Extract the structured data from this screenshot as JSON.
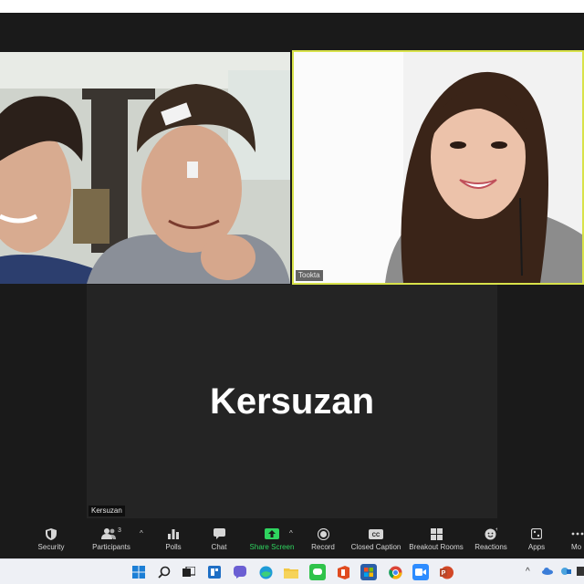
{
  "participants": [
    {
      "id": "p1",
      "name": ""
    },
    {
      "id": "p2",
      "name": "Tookta"
    },
    {
      "id": "p3",
      "name": "Kersuzan",
      "display_name": "Kersuzan"
    }
  ],
  "toolbar": {
    "security": "Security",
    "participants": "Participants",
    "participants_count": "3",
    "polls": "Polls",
    "chat": "Chat",
    "share_screen": "Share Screen",
    "record": "Record",
    "closed_caption": "Closed Caption",
    "breakout_rooms": "Breakout Rooms",
    "reactions": "Reactions",
    "apps": "Apps",
    "more": "Mo"
  },
  "colors": {
    "active_speaker_border": "#d8e24a",
    "share_green": "#2fd45f",
    "stage_bg": "#1a1a1a"
  },
  "taskbar": {
    "icons": [
      "windows-start-icon",
      "search-icon",
      "task-view-icon",
      "widgets-icon",
      "teams-chat-icon",
      "edge-icon",
      "file-explorer-icon",
      "line-icon",
      "office-icon",
      "store-icon",
      "chrome-icon",
      "zoom-icon",
      "powerpoint-icon"
    ]
  }
}
